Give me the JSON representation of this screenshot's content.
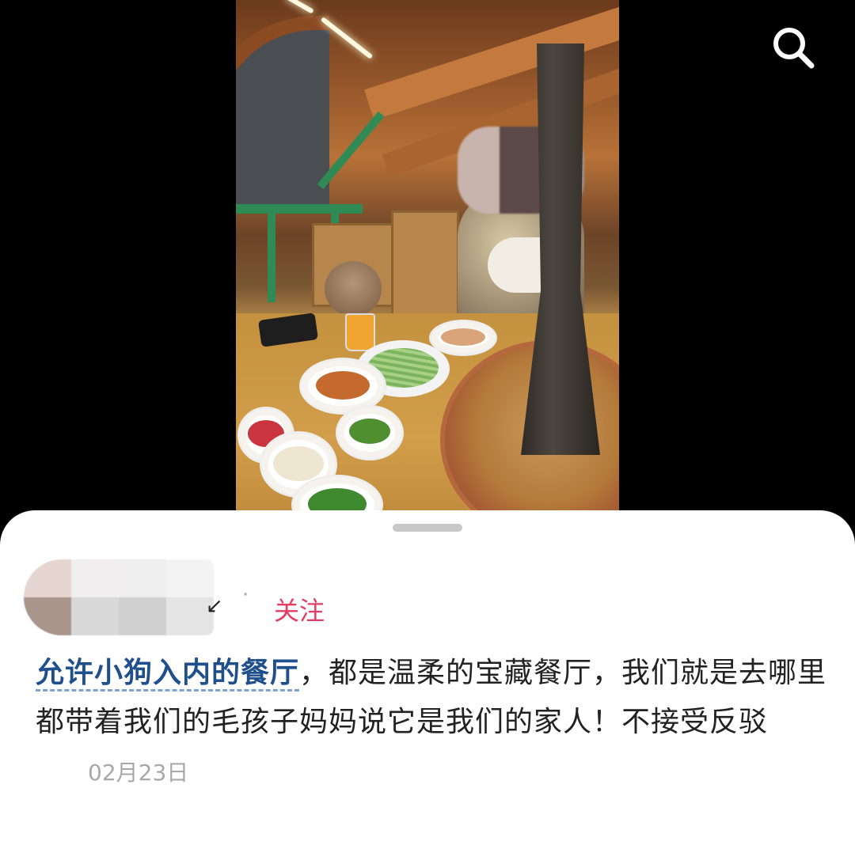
{
  "header": {
    "search_icon": "search-icon"
  },
  "post": {
    "author": {
      "name_visible": "↙"
    },
    "follow_label": "关注",
    "separator": "·",
    "topic_link": "允许小狗入内的餐厅",
    "body": "，都是温柔的宝藏餐厅，我们就是去哪里都带着我们的毛孩子妈妈说它是我们的家人！不接受反驳",
    "date": "02月23日"
  },
  "colors": {
    "follow": "#e43d63",
    "topic": "#1f4f8c",
    "date": "#a8a8a8"
  }
}
